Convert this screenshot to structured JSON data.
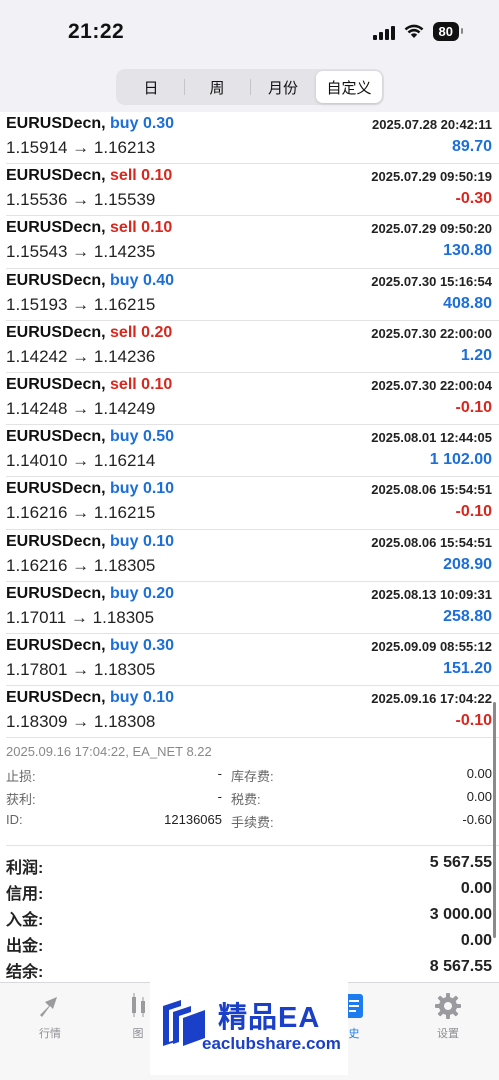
{
  "status_bar": {
    "time": "21:22",
    "battery": "80"
  },
  "segments": [
    {
      "label": "日",
      "active": false
    },
    {
      "label": "周",
      "active": false
    },
    {
      "label": "月份",
      "active": false
    },
    {
      "label": "自定义",
      "active": true
    }
  ],
  "deals": [
    {
      "symbol": "EURUSDecn,",
      "side": "buy",
      "volume": "0.30",
      "time": "2025.07.28 20:42:11",
      "prices": "1.15914 → 1.16213",
      "profit": "89.70",
      "profit_sign": "pos"
    },
    {
      "symbol": "EURUSDecn,",
      "side": "sell",
      "volume": "0.10",
      "time": "2025.07.29 09:50:19",
      "prices": "1.15536 → 1.15539",
      "profit": "-0.30",
      "profit_sign": "neg"
    },
    {
      "symbol": "EURUSDecn,",
      "side": "sell",
      "volume": "0.10",
      "time": "2025.07.29 09:50:20",
      "prices": "1.15543 → 1.14235",
      "profit": "130.80",
      "profit_sign": "pos"
    },
    {
      "symbol": "EURUSDecn,",
      "side": "buy",
      "volume": "0.40",
      "time": "2025.07.30 15:16:54",
      "prices": "1.15193 → 1.16215",
      "profit": "408.80",
      "profit_sign": "pos"
    },
    {
      "symbol": "EURUSDecn,",
      "side": "sell",
      "volume": "0.20",
      "time": "2025.07.30 22:00:00",
      "prices": "1.14242 → 1.14236",
      "profit": "1.20",
      "profit_sign": "pos"
    },
    {
      "symbol": "EURUSDecn,",
      "side": "sell",
      "volume": "0.10",
      "time": "2025.07.30 22:00:04",
      "prices": "1.14248 → 1.14249",
      "profit": "-0.10",
      "profit_sign": "neg"
    },
    {
      "symbol": "EURUSDecn,",
      "side": "buy",
      "volume": "0.50",
      "time": "2025.08.01 12:44:05",
      "prices": "1.14010 → 1.16214",
      "profit": "1 102.00",
      "profit_sign": "pos"
    },
    {
      "symbol": "EURUSDecn,",
      "side": "buy",
      "volume": "0.10",
      "time": "2025.08.06 15:54:51",
      "prices": "1.16216 → 1.16215",
      "profit": "-0.10",
      "profit_sign": "neg"
    },
    {
      "symbol": "EURUSDecn,",
      "side": "buy",
      "volume": "0.10",
      "time": "2025.08.06 15:54:51",
      "prices": "1.16216 → 1.18305",
      "profit": "208.90",
      "profit_sign": "pos"
    },
    {
      "symbol": "EURUSDecn,",
      "side": "buy",
      "volume": "0.20",
      "time": "2025.08.13 10:09:31",
      "prices": "1.17011 → 1.18305",
      "profit": "258.80",
      "profit_sign": "pos"
    },
    {
      "symbol": "EURUSDecn,",
      "side": "buy",
      "volume": "0.30",
      "time": "2025.09.09 08:55:12",
      "prices": "1.17801 → 1.18305",
      "profit": "151.20",
      "profit_sign": "pos"
    },
    {
      "symbol": "EURUSDecn,",
      "side": "buy",
      "volume": "0.10",
      "time": "2025.09.16 17:04:22",
      "prices": "1.18309 → 1.18308",
      "profit": "-0.10",
      "profit_sign": "neg"
    }
  ],
  "detail": {
    "header": "2025.09.16 17:04:22, EA_NET 8.22",
    "rows": [
      {
        "l1": "止损:",
        "v1": "-",
        "l2": "库存费:",
        "v2": "0.00"
      },
      {
        "l1": "获利:",
        "v1": "-",
        "l2": "税费:",
        "v2": "0.00"
      },
      {
        "l1": "ID:",
        "v1": "12136065",
        "l2": "手续费:",
        "v2": "-0.60"
      }
    ]
  },
  "summary": [
    {
      "label": "利润:",
      "value": "5 567.55"
    },
    {
      "label": "信用:",
      "value": "0.00"
    },
    {
      "label": "入金:",
      "value": "3 000.00"
    },
    {
      "label": "出金:",
      "value": "0.00"
    },
    {
      "label": "结余:",
      "value": "8 567.55"
    }
  ],
  "tabs": [
    {
      "label": "行情",
      "icon": "quotes-icon",
      "active": false
    },
    {
      "label": "图",
      "icon": "chart-icon",
      "active": false
    },
    {
      "label": "史",
      "icon": "history-icon",
      "active": true
    },
    {
      "label": "设置",
      "icon": "gear-icon",
      "active": false
    }
  ],
  "watermark": {
    "text_cn": "精品EA",
    "url": "eaclubshare.com"
  },
  "colors": {
    "buy": "#1c6fd8",
    "sell": "#d9271e",
    "active_tab": "#1c7cf0",
    "watermark": "#1a3fc9"
  }
}
